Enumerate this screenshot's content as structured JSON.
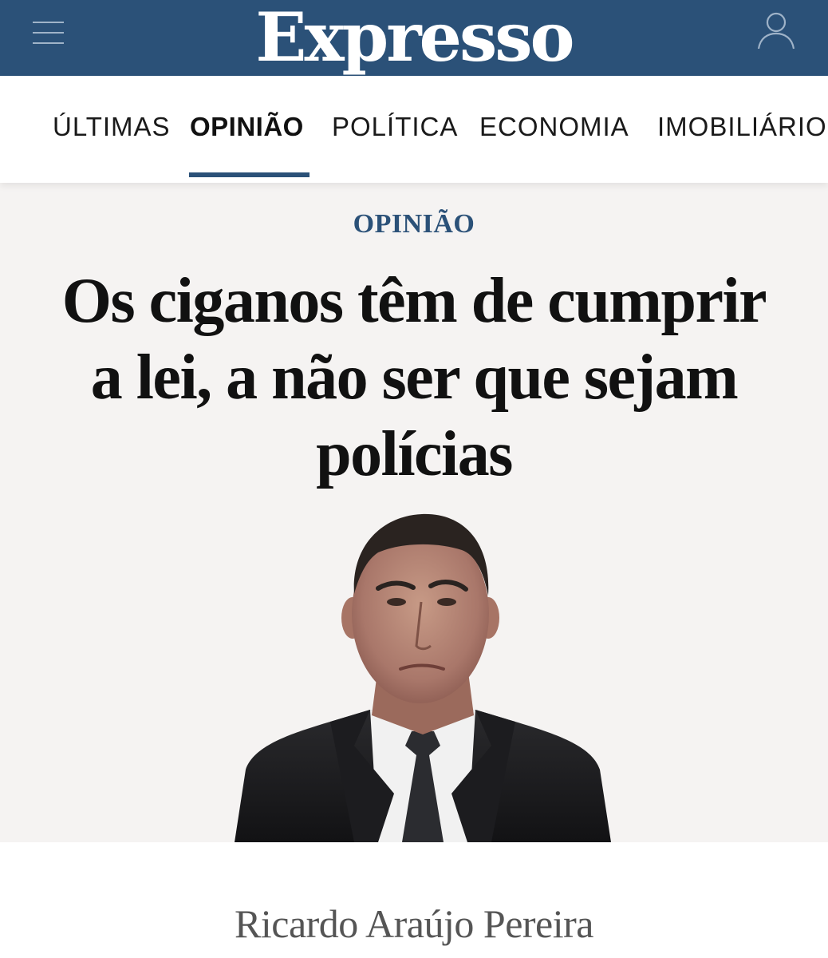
{
  "header": {
    "logo_text": "Expresso",
    "brand_color": "#2b5178",
    "menu_icon": "hamburger-menu-icon",
    "user_icon": "user-account-icon"
  },
  "nav": {
    "items": [
      {
        "label": "ÚLTIMAS",
        "active": false
      },
      {
        "label": "OPINIÃO",
        "active": true
      },
      {
        "label": "POLÍTICA",
        "active": false
      },
      {
        "label": "ECONOMIA",
        "active": false
      },
      {
        "label": "IMOBILIÁRIO",
        "active": false
      }
    ]
  },
  "article": {
    "section": "OPINIÃO",
    "headline": "Os ciganos têm de cumprir a lei, a não ser que sejam polícias",
    "author": "Ricardo Araújo Pereira",
    "background": "#f5f3f2"
  }
}
